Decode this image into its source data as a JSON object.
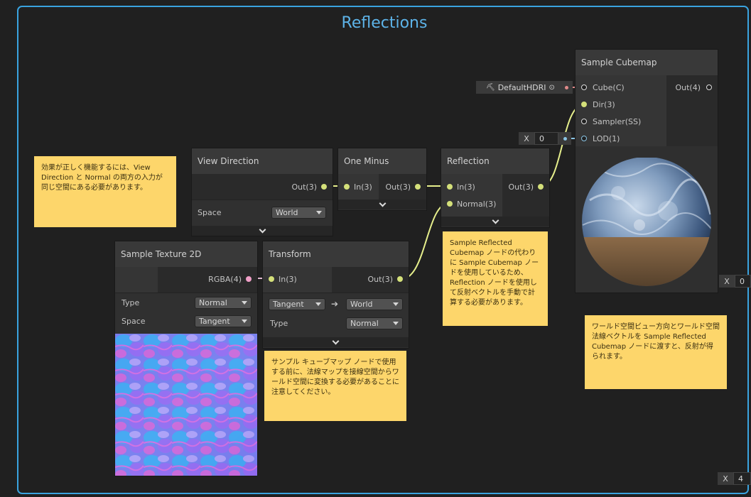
{
  "group": {
    "title": "Reflections"
  },
  "notes": {
    "n1": "効果が正しく機能するには、View Direction と Normal の両方の入力が同じ空間にある必要があります。",
    "n2": "Sample Reflected Cubemap ノードの代わりに Sample Cubemap ノードを使用しているため、Reflection ノードを使用して反射ベクトルを手動で計算する必要があります。",
    "n3": "サンプル キューブマップ ノードで使用する前に、法線マップを接線空間からワールド空間に変換する必要があることに注意してください。",
    "n4": "ワールド空間ビュー方向とワールド空間法線ベクトルを Sample Reflected Cubemap ノードに渡すと、反射が得られます。"
  },
  "view_direction": {
    "title": "View Direction",
    "out": "Out(3)",
    "space_label": "Space",
    "space_value": "World"
  },
  "one_minus": {
    "title": "One Minus",
    "in": "In(3)",
    "out": "Out(3)"
  },
  "reflection": {
    "title": "Reflection",
    "in": "In(3)",
    "normal": "Normal(3)",
    "out": "Out(3)"
  },
  "sample_cubemap": {
    "title": "Sample Cubemap",
    "cube": "Cube(C)",
    "dir": "Dir(3)",
    "sampler": "Sampler(SS)",
    "lod": "LOD(1)",
    "out": "Out(4)"
  },
  "default_hdri": {
    "label": "DefaultHDRI"
  },
  "lod_field": {
    "x": "X",
    "value": "0"
  },
  "preview_field": {
    "x": "X",
    "value": "0"
  },
  "bottom_field": {
    "x": "X",
    "value": "4"
  },
  "sample_texture": {
    "title": "Sample Texture 2D",
    "out": "RGBA(4)",
    "type_label": "Type",
    "type_value": "Normal",
    "space_label": "Space",
    "space_value": "Tangent"
  },
  "transform": {
    "title": "Transform",
    "in": "In(3)",
    "out": "Out(3)",
    "from_value": "Tangent",
    "arrow": "➔",
    "to_value": "World",
    "type_label": "Type",
    "type_value": "Normal"
  },
  "colors": {
    "accent": "#3aa3df",
    "note": "#fdd66b",
    "wire_vec3": "#e6ef8c",
    "wire_blue": "#8ac4e4",
    "wire_red": "#e08a8a"
  }
}
